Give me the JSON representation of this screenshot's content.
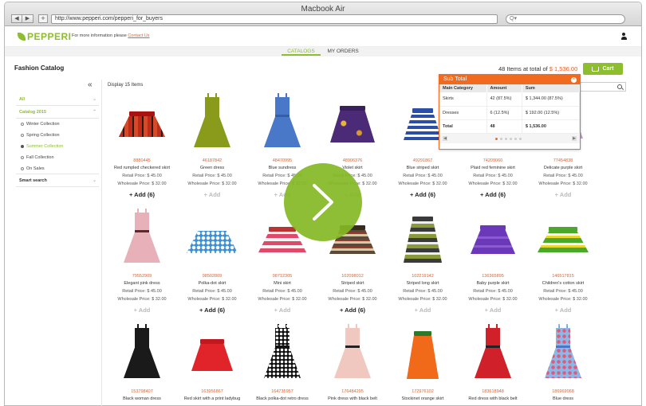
{
  "window": {
    "title": "Macbook Air",
    "url": "http://www.pepperi.com/pepperi_for_buyers",
    "nav_back": "◀",
    "nav_forward": "▶",
    "add_tab": "+",
    "search_placeholder": "Q▾"
  },
  "header": {
    "logo": "PEPPERI",
    "info_text": "For more information please",
    "info_link": "Contact Us"
  },
  "nav": {
    "tabs": [
      {
        "label": "CATALOGS",
        "active": true
      },
      {
        "label": "MY ORDERS",
        "active": false
      }
    ]
  },
  "catalog": {
    "title": "Fashion Catalog",
    "items_total_prefix": "48 Items at total of",
    "items_total_amount": "$ 1,536.00",
    "cart_label": "Cart",
    "display_count": "Display 15 Items",
    "collapse": "«"
  },
  "sidebar": {
    "all": "All",
    "catalog": "Catalog 2015",
    "collections": [
      "Winter Collection",
      "Spring Collection",
      "Summer Collection",
      "Fall Collection",
      "On Sales"
    ],
    "selected_collection": "Summer Collection",
    "smart_search": "Smart search"
  },
  "subtotal": {
    "title": "Sub Total",
    "close": "×",
    "headers": [
      "Main Category",
      "Amount",
      "Sum"
    ],
    "rows": [
      [
        "Skirts",
        "42 (87.5%)",
        "$ 1,344.00 (87.5%)"
      ],
      [
        "Dresses",
        "6 (12.5%)",
        "$ 192.00 (12.5%)"
      ],
      [
        "Total",
        "48",
        "$ 1,536.00"
      ]
    ],
    "prev": "◀",
    "next": "▶"
  },
  "products": [
    {
      "code": "8880445",
      "name": "Red rumpled checkered skirt",
      "retail": "Retail Price: $ 45.00",
      "wholesale": "Wholesale Price: $ 32.00",
      "add": "Add (6)",
      "active": true
    },
    {
      "code": "46187842",
      "name": "Green dress",
      "retail": "Retail Price: $ 45.00",
      "wholesale": "Wholesale Price: $ 32.00",
      "add": "Add",
      "active": false
    },
    {
      "code": "48470995",
      "name": "Blue sundress",
      "retail": "Retail Price: $ 45.00",
      "wholesale": "Wholesale Price: $ 32.00",
      "add": "Add",
      "active": false
    },
    {
      "code": "48906376",
      "name": "Violet skirt",
      "retail": "Retail Price: $ 45.00",
      "wholesale": "Wholesale Price: $ 32.00",
      "add": "Add",
      "active": false
    },
    {
      "code": "49291867",
      "name": "Blue striped skirt",
      "retail": "Retail Price: $ 45.00",
      "wholesale": "Wholesale Price: $ 32.00",
      "add": "Add (6)",
      "active": true
    },
    {
      "code": "74209060",
      "name": "Plaid red feminine skirt",
      "retail": "Retail Price: $ 45.00",
      "wholesale": "Wholesale Price: $ 32.00",
      "add": "Add (6)",
      "active": true
    },
    {
      "code": "77454838",
      "name": "Delicate purple skirt",
      "retail": "Retail Price: $ 45.00",
      "wholesale": "Wholesale Price: $ 32.00",
      "add": "Add",
      "active": false
    },
    {
      "code": "79552909",
      "name": "Elegant pink dress",
      "retail": "Retail Price: $ 45.00",
      "wholesale": "Wholesale Price: $ 32.00",
      "add": "Add",
      "active": false
    },
    {
      "code": "98502809",
      "name": "Polka-dot skirt",
      "retail": "Retail Price: $ 45.00",
      "wholesale": "Wholesale Price: $ 32.00",
      "add": "Add (6)",
      "active": true
    },
    {
      "code": "98712305",
      "name": "Mini skirt",
      "retail": "Retail Price: $ 45.00",
      "wholesale": "Wholesale Price: $ 32.00",
      "add": "Add",
      "active": false
    },
    {
      "code": "102098012",
      "name": "Striped skirt",
      "retail": "Retail Price: $ 45.00",
      "wholesale": "Wholesale Price: $ 32.00",
      "add": "Add (6)",
      "active": true
    },
    {
      "code": "102219142",
      "name": "Striped long skirt",
      "retail": "Retail Price: $ 45.00",
      "wholesale": "Wholesale Price: $ 32.00",
      "add": "Add",
      "active": false
    },
    {
      "code": "136365895",
      "name": "Baby purple skirt",
      "retail": "Retail Price: $ 45.00",
      "wholesale": "Wholesale Price: $ 32.00",
      "add": "Add",
      "active": false
    },
    {
      "code": "146517815",
      "name": "Children's cotton skirt",
      "retail": "Retail Price: $ 45.00",
      "wholesale": "Wholesale Price: $ 32.00",
      "add": "Add",
      "active": false
    },
    {
      "code": "153798407",
      "name": "Black woman dress",
      "retail": "",
      "wholesale": "",
      "add": "",
      "active": false
    },
    {
      "code": "163956867",
      "name": "Red skirt with a print ladybug",
      "retail": "",
      "wholesale": "",
      "add": "",
      "active": false
    },
    {
      "code": "164735957",
      "name": "Black polka-dot retro dress",
      "retail": "",
      "wholesale": "",
      "add": "",
      "active": false
    },
    {
      "code": "176484295",
      "name": "Pink dress with black belt",
      "retail": "",
      "wholesale": "",
      "add": "",
      "active": false
    },
    {
      "code": "172976102",
      "name": "Stockinet orange skirt",
      "retail": "",
      "wholesale": "",
      "add": "",
      "active": false
    },
    {
      "code": "183618948",
      "name": "Red dress with black belt",
      "retail": "",
      "wholesale": "",
      "add": "",
      "active": false
    },
    {
      "code": "186969068",
      "name": "Blue dress",
      "retail": "",
      "wholesale": "",
      "add": "",
      "active": false
    }
  ],
  "colors": {
    "brand": "#8cbe2d",
    "accent": "#e5602b",
    "popup": "#f06a1f"
  }
}
